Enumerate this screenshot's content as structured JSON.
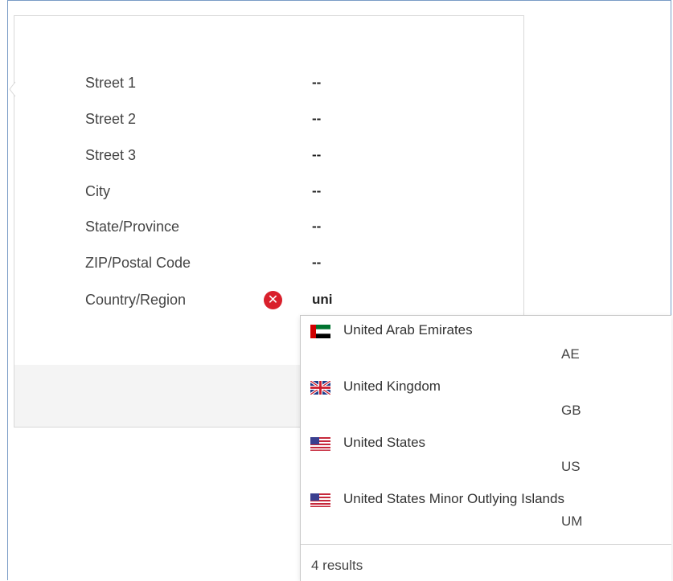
{
  "form": {
    "fields": [
      {
        "label": "Street 1",
        "value": "--"
      },
      {
        "label": "Street 2",
        "value": "--"
      },
      {
        "label": "Street 3",
        "value": "--"
      },
      {
        "label": "City",
        "value": "--"
      },
      {
        "label": "State/Province",
        "value": "--"
      },
      {
        "label": "ZIP/Postal Code",
        "value": "--"
      },
      {
        "label": "Country/Region",
        "value": "uni"
      }
    ],
    "country_error_icon": "error-circle-x-icon",
    "error_color": "#d9202c"
  },
  "dropdown": {
    "options": [
      {
        "name": "United Arab Emirates",
        "code": "AE",
        "flag": "uae-flag-icon"
      },
      {
        "name": "United Kingdom",
        "code": "GB",
        "flag": "uk-flag-icon"
      },
      {
        "name": "United States",
        "code": "US",
        "flag": "us-flag-icon"
      },
      {
        "name": "United States Minor Outlying Islands",
        "code": "UM",
        "flag": "us-flag-icon"
      }
    ],
    "results_text": "4 results"
  },
  "colors": {
    "frame_border": "#7a9cc6",
    "card_footer": "#f4f4f4"
  }
}
